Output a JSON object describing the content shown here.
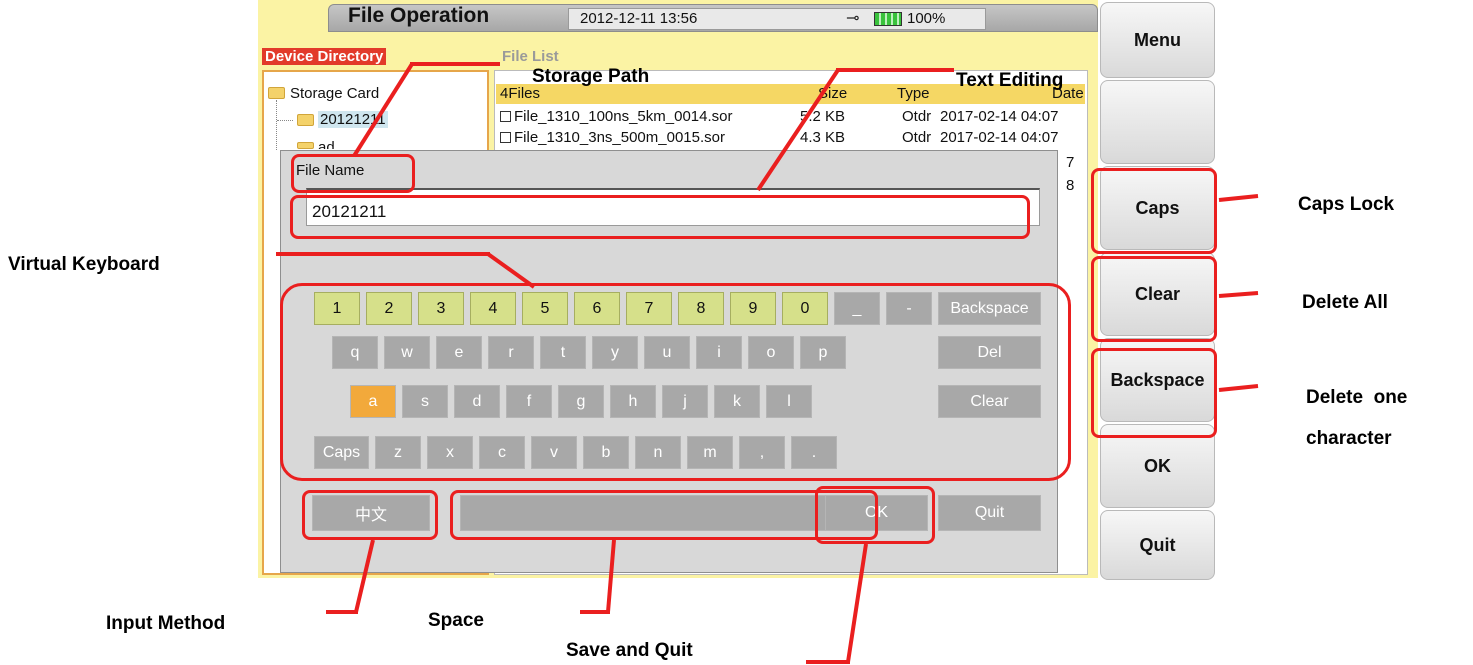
{
  "device": {
    "title": "File Operation",
    "datetime": "2012-12-11 13:56",
    "plug_icon": "⊸",
    "battery": "100%"
  },
  "menu": {
    "items": [
      "Menu",
      "",
      "Caps",
      "Clear",
      "Backspace",
      "OK",
      "Quit"
    ]
  },
  "left_panel": {
    "label": "Device Directory",
    "tree": [
      "Storage Card",
      "20121211",
      "ad"
    ]
  },
  "file_list": {
    "label": "File List",
    "count_label": "4Files",
    "headers": [
      "Size",
      "Type",
      "Date"
    ],
    "rows": [
      {
        "name": "File_1310_100ns_5km_0014.sor",
        "size": "5.2 KB",
        "type": "Otdr",
        "date": "2017-02-14 04:07"
      },
      {
        "name": "File_1310_3ns_500m_0015.sor",
        "size": "4.3 KB",
        "type": "Otdr",
        "date": "2017-02-14 04:07"
      }
    ],
    "partial_dates": [
      "7",
      "8"
    ]
  },
  "dialog": {
    "file_name_label": "File Name",
    "file_name_value": "20121211",
    "keys_row1": [
      "1",
      "2",
      "3",
      "4",
      "5",
      "6",
      "7",
      "8",
      "9",
      "0",
      "_",
      "-",
      "Backspace"
    ],
    "keys_row2": [
      "q",
      "w",
      "e",
      "r",
      "t",
      "y",
      "u",
      "i",
      "o",
      "p"
    ],
    "keys_row3": [
      "a",
      "s",
      "d",
      "f",
      "g",
      "h",
      "j",
      "k",
      "l"
    ],
    "keys_row4": [
      "Caps",
      "z",
      "x",
      "c",
      "v",
      "b",
      "n",
      "m",
      ",",
      "."
    ],
    "side_keys": [
      "Del",
      "Clear"
    ],
    "bottom": {
      "ime": "中文",
      "space": "",
      "ok": "OK",
      "quit": "Quit"
    },
    "selected_key": "a"
  },
  "callouts": {
    "storage_path": "Storage Path",
    "text_editing": "Text Editing",
    "caps_lock": "Caps Lock",
    "virtual_keyboard": "Virtual Keyboard",
    "delete_all": "Delete All",
    "delete_one_line1": "Delete  one",
    "delete_one_line2": "character",
    "input_method": "Input Method",
    "space": "Space",
    "save_and_quit": "Save and Quit"
  },
  "colors": {
    "annotation": "#ea1f1f",
    "screen_bg": "#fbf3a4",
    "selected_key": "#f2a93b",
    "number_key": "#d6e08a",
    "device_directory_label": "#e23a2a"
  }
}
